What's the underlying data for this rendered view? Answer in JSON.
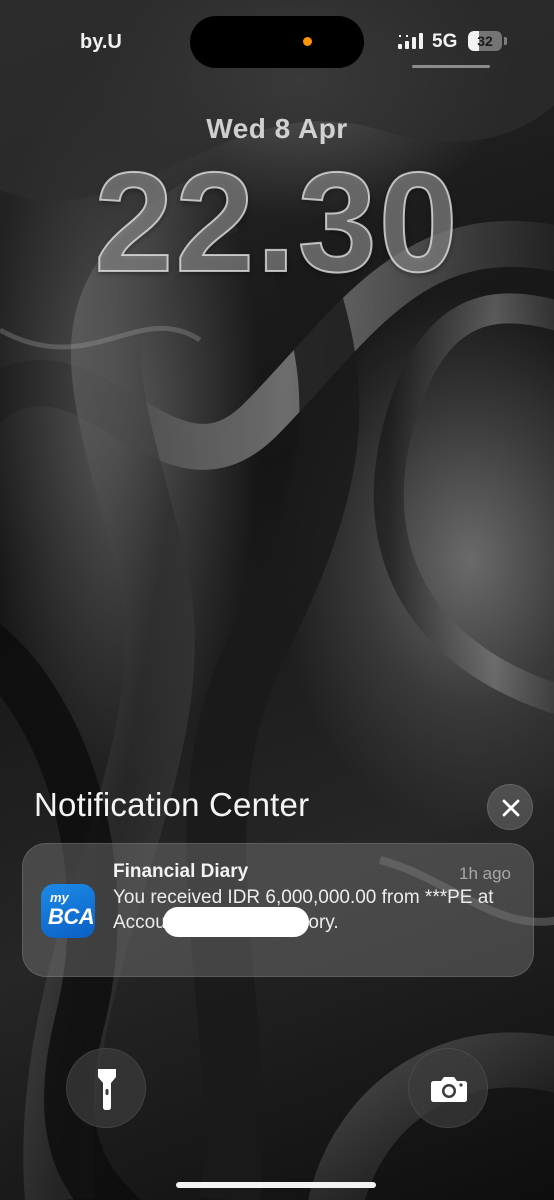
{
  "status_bar": {
    "carrier": "by.U",
    "network": "5G",
    "battery_level": "32",
    "battery_fraction": 0.32,
    "privacy_dot_color": "#ff9500",
    "signal_icon": "cellular-signal-icon"
  },
  "lock_screen": {
    "date": "Wed 8 Apr",
    "time": "22.30"
  },
  "notification_center": {
    "title": "Notification Center",
    "clear_icon": "close-icon",
    "notifications": [
      {
        "app_name": "Financial Diary",
        "app_icon": "mybca-app-icon",
        "icon_text_small": "my",
        "icon_text_large": "BCA",
        "time_ago": "1h ago",
        "body": "You received IDR 6,000,000.00 from ***PE                    at Account Transfer category.",
        "accent_color": "#0b5fc4"
      }
    ]
  },
  "quick_actions": {
    "left_icon": "flashlight-icon",
    "right_icon": "camera-icon"
  }
}
